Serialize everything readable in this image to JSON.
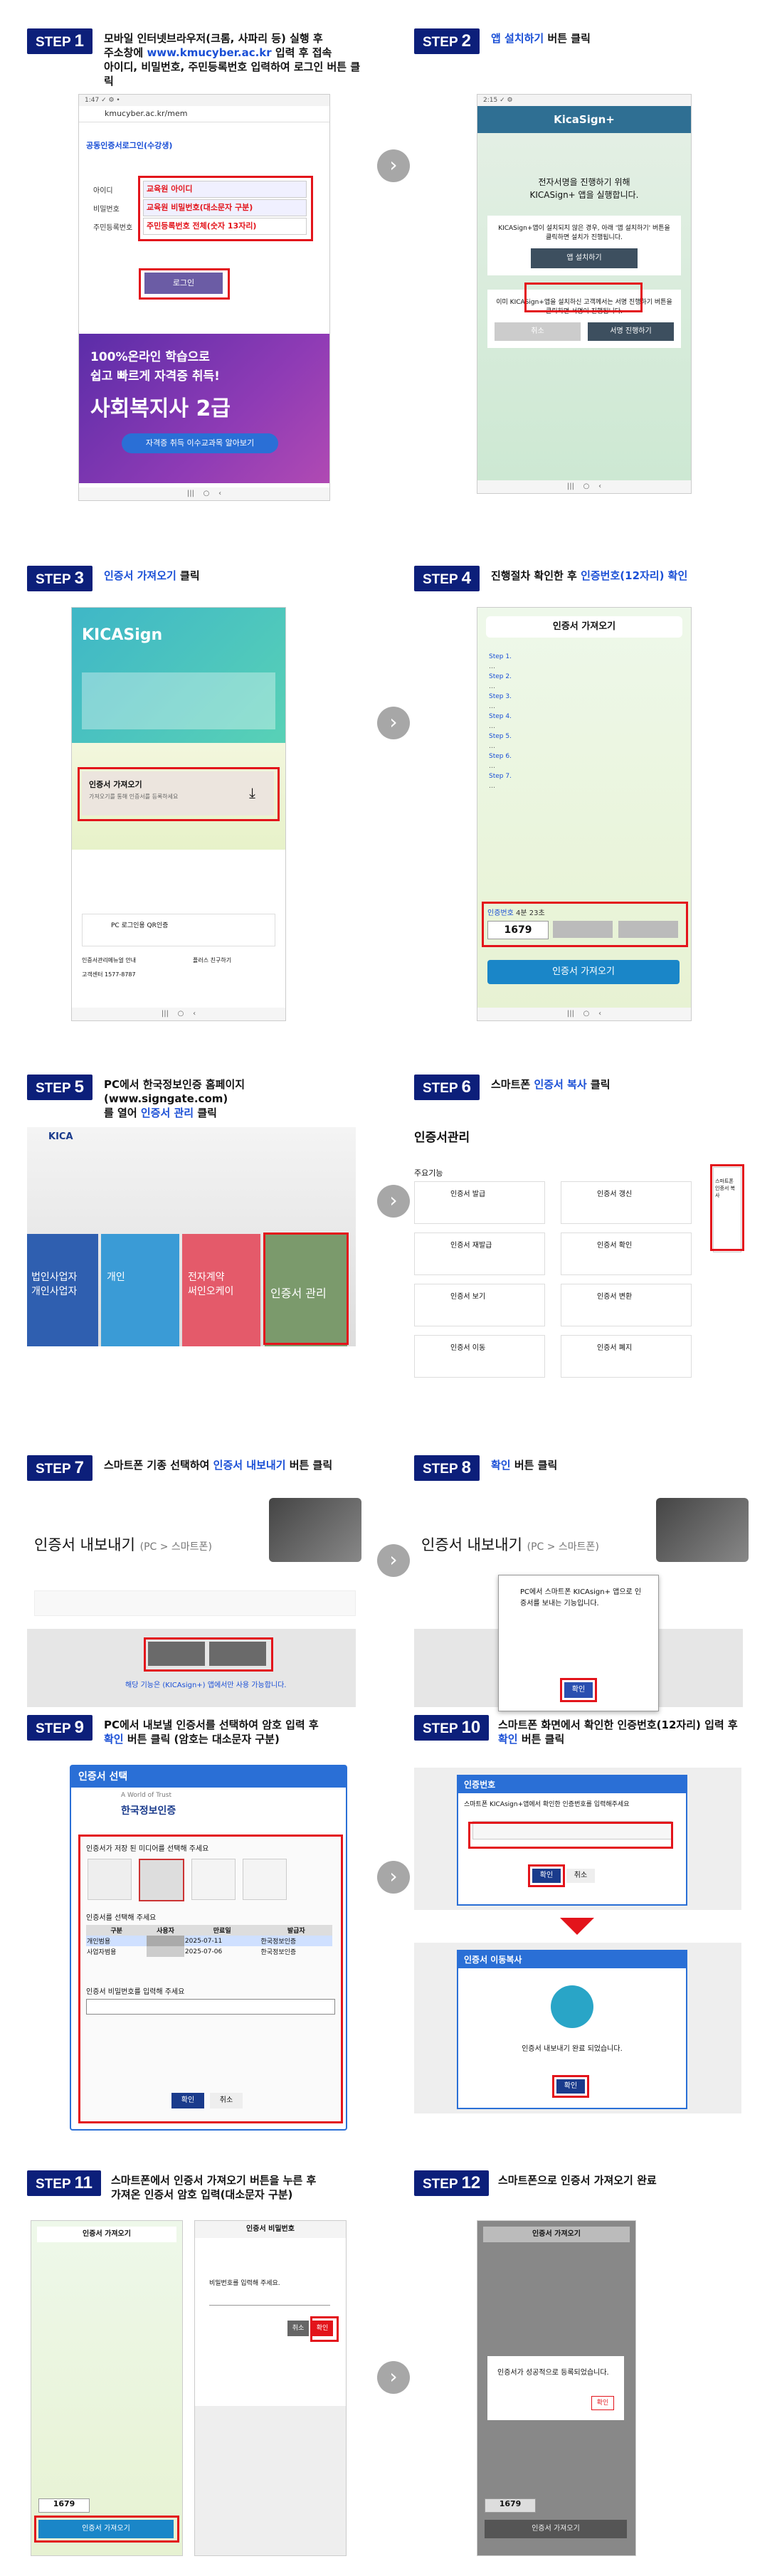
{
  "steps": [
    {
      "badge": "STEP",
      "num": "1",
      "lines": [
        "모바일 인터넷브라우저(크롬, 사파리 등) 실행 후",
        "주소창에 ",
        "www.kmucyber.ac.kr",
        " 입력 후 접속",
        "아이디, 비밀번호, 주민등록번호 입력하여 로그인 버튼 클릭"
      ]
    },
    {
      "badge": "STEP",
      "num": "2",
      "pre": "",
      "hl": "앱 설치하기",
      "post": " 버튼 클릭"
    },
    {
      "badge": "STEP",
      "num": "3",
      "pre": "",
      "hl": "인증서 가져오기",
      "post": " 클릭"
    },
    {
      "badge": "STEP",
      "num": "4",
      "pre": "진행절차 확인한 후 ",
      "hl": "인증번호(12자리) 확인",
      "post": ""
    },
    {
      "badge": "STEP",
      "num": "5",
      "l1": "PC에서 한국정보인증 홈페이지(www.signgate.com)",
      "l2pre": "를 열어 ",
      "hl": "인증서 관리",
      "l2post": " 클릭"
    },
    {
      "badge": "STEP",
      "num": "6",
      "pre": "스마트폰 ",
      "hl": "인증서 복사",
      "post": " 클릭"
    },
    {
      "badge": "STEP",
      "num": "7",
      "pre": "스마트폰 기종 선택하여 ",
      "hl": "인증서 내보내기",
      "post": " 버튼 클릭"
    },
    {
      "badge": "STEP",
      "num": "8",
      "pre": "",
      "hl": "확인",
      "post": " 버튼 클릭"
    },
    {
      "badge": "STEP",
      "num": "9",
      "l1": "PC에서 내보낼 인증서를 선택하여 암호 입력 후",
      "l2pre": "",
      "hl": "확인",
      "l2post": " 버튼 클릭 (암호는 대소문자 구분)"
    },
    {
      "badge": "STEP",
      "num": "10",
      "l1": "스마트폰 화면에서 확인한 인증번호(12자리) 입력 후",
      "l2pre": "",
      "hl": "확인",
      "l2post": " 버튼 클릭"
    },
    {
      "badge": "STEP",
      "num": "11",
      "l1": "스마트폰에서 인증서 가져오기 버튼을 누른 후",
      "l2pre": "",
      "hl": "",
      "l2post": "가져온 인증서 암호 입력(대소문자 구분)"
    },
    {
      "badge": "STEP",
      "num": "12",
      "pre": "스마트폰으로 인증서 가져오기 완료",
      "hl": "",
      "post": ""
    }
  ],
  "s1": {
    "url": "kmucyber.ac.kr/mem",
    "title": "공동인증서로그인(수강생)",
    "id_label": "아이디",
    "pw_label": "비밀번호",
    "rrn_label": "주민등록번호",
    "id_ph": "교육원 아이디",
    "pw_ph": "교육원 비밀번호(대소문자 구분)",
    "rrn_ph": "주민등록번호 전체(숫자 13자리)",
    "login": "로그인",
    "banner1": "100%온라인 학습으로",
    "banner2": "쉽고 빠르게 자격증 취득!",
    "banner3": "사회복지사 2급",
    "banner4": "자격증 취득 이수교과목 알아보기"
  },
  "s2": {
    "app": "KicaSign+",
    "msg1": "전자서명을 진행하기 위해",
    "msg2": "KICASign+ 앱을 실행합니다.",
    "msg3": "KICASign+앱이 설치되지 않은 경우, 아래 '앱 설치하기' 버튼을 클릭하면 설치가 진행됩니다.",
    "install": "앱 설치하기",
    "msg4": "이미 KICASign+앱을 설치하신 고객께서는 서명 진행하기 버튼을 클릭하면 서명이 진행됩니다.",
    "cancel": "취소",
    "sign": "서명 진행하기"
  },
  "s3": {
    "logo": "KICASign",
    "import": "인증서 가져오기",
    "import_sub": "가져오기를 통해 인증서를 등록하세요",
    "pc": "PC 로그인용 QR인증",
    "help1": "인증서관리메뉴얼 안내",
    "help2": "플러스 친구하기",
    "tel": "고객센터 1577-8787"
  },
  "s4": {
    "title": "인증서 가져오기",
    "s1": "Step 1.",
    "s2": "Step 2.",
    "s3": "Step 3.",
    "s4": "Step 4.",
    "s5": "Step 5.",
    "s6": "Step 6.",
    "s7": "Step 7.",
    "code_label": "인증번호",
    "timer": "4분 23초",
    "code1": "1679",
    "btn": "인증서 가져오기"
  },
  "s5": {
    "logo": "KICA",
    "tile1": "법인사업자\n개인사업자",
    "tile2": "개인",
    "tile3": "전자계약\n써인오케이",
    "tile4": "인증서 관리"
  },
  "s6": {
    "title": "인증서관리",
    "main": "주요기능",
    "items": [
      "인증서 발급",
      "인증서 갱신",
      "인증서 재발급",
      "인증서 확인",
      "인증서 보기",
      "인증서 변환",
      "인증서 이동",
      "인증서 폐지"
    ],
    "copy": "스마트폰 인증서 복사"
  },
  "s7": {
    "title": "인증서 내보내기",
    "sub": "(PC > 스마트폰)",
    "note": "해당 기능은",
    "note2": "(KICAsign+) 앱에서만 사용 가능합니다."
  },
  "s8": {
    "title": "인증서 내보내기",
    "sub": "(PC > 스마트폰)",
    "popup": "PC에서 스마트폰 KICAsign+ 앱으로 인증서를 보내는 기능입니다.",
    "ok": "확인"
  },
  "s9": {
    "title": "인증서 선택",
    "brand": "한국정보인증",
    "tagline": "A World of Trust",
    "select": "인증서가 저장 된 미디어를 선택해 주세요",
    "list": "인증서를 선택해 주세요",
    "cols": [
      "구분",
      "사용자",
      "만료일",
      "발급자"
    ],
    "rows": [
      [
        "개인범용",
        "",
        "2025-07-11",
        "한국정보인증"
      ],
      [
        "사업자범용",
        "",
        "2025-07-06",
        "한국정보인증"
      ]
    ],
    "pw": "인증서 비밀번호를 입력해 주세요",
    "ok": "확인",
    "cancel": "취소"
  },
  "s10": {
    "title": "인증번호",
    "msg": "스마트폰 KICAsign+앱에서 확인한 인증번호를 입력해주세요",
    "ok": "확인",
    "cancel": "취소",
    "title2": "인증서 이동복사",
    "done": "인증서 내보내기 완료 되었습니다.",
    "ok2": "확인"
  },
  "s11": {
    "title": "인증서 가져오기",
    "pw_title": "인증서 비밀번호",
    "pw_prompt": "비밀번호를 입력해 주세요.",
    "cancel": "취소",
    "ok": "확인",
    "code": "1679",
    "btn": "인증서 가져오기"
  },
  "s12": {
    "title": "인증서 가져오기",
    "msg": "인증서가 성공적으로 등록되었습니다.",
    "ok": "확인",
    "code": "1679",
    "btn": "인증서 가져오기"
  }
}
